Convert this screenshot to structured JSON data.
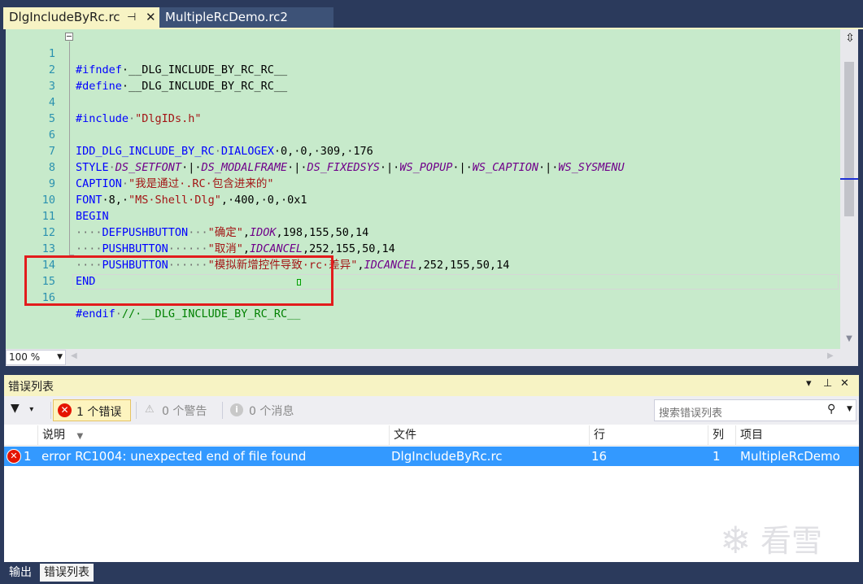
{
  "doc_tabs": [
    {
      "label": "DlgIncludeByRc.rc",
      "active": true
    },
    {
      "label": "MultipleRcDemo.rc2",
      "active": false
    }
  ],
  "editor": {
    "background": "#c7eacb",
    "line_numbers": [
      "1",
      "2",
      "3",
      "4",
      "5",
      "6",
      "7",
      "8",
      "9",
      "10",
      "11",
      "12",
      "13",
      "14",
      "15",
      "16"
    ],
    "lines": {
      "l1": {
        "a": "#ifndef",
        "b": "·__DLG_INCLUDE_BY_RC_RC__"
      },
      "l2": {
        "a": "#define",
        "b": "·__DLG_INCLUDE_BY_RC_RC__"
      },
      "l4": {
        "a": "#include",
        "b": "·",
        "c": "\"DlgIDs.h\""
      },
      "l6": {
        "a": "IDD_DLG_INCLUDE_BY_RC",
        "b": "·",
        "c": "DIALOGEX",
        "d": "·0,·0,·309,·176"
      },
      "l7": {
        "a": "STYLE",
        "b": "·",
        "c": "DS_SETFONT",
        "d": "·|·",
        "e": "DS_MODALFRAME",
        "f": "·|·",
        "g": "DS_FIXEDSYS",
        "h": "·|·",
        "i": "WS_POPUP",
        "j": "·|·",
        "k": "WS_CAPTION",
        "l": "·|·",
        "m": "WS_SYSMENU"
      },
      "l8": {
        "a": "CAPTION",
        "b": "·",
        "c": "\"我是通过·.RC·包含进来的\""
      },
      "l9": {
        "a": "FONT",
        "b": "·8,·",
        "c": "\"MS·Shell·Dlg\"",
        "d": ",·400,·0,·0x1"
      },
      "l10": {
        "a": "BEGIN"
      },
      "l11": {
        "a": "····",
        "b": "DEFPUSHBUTTON",
        "c": "···",
        "d": "\"确定\"",
        "e": ",",
        "f": "IDOK",
        "g": ",198,155,50,14"
      },
      "l12": {
        "a": "····",
        "b": "PUSHBUTTON",
        "c": "······",
        "d": "\"取消\"",
        "e": ",",
        "f": "IDCANCEL",
        "g": ",252,155,50,14"
      },
      "l13": {
        "a": "····",
        "b": "PUSHBUTTON",
        "c": "······",
        "d": "\"模拟新增控件导致·rc·差异\"",
        "e": ",",
        "f": "IDCANCEL",
        "g": ",252,155,50,14"
      },
      "l14": {
        "a": "END"
      },
      "l16": {
        "a": "#endif",
        "b": "·",
        "c": "//·__DLG_INCLUDE_BY_RC_RC__"
      }
    },
    "zoom": "100 %"
  },
  "error_list": {
    "title": "错误列表",
    "errors_label": "1 个错误",
    "warnings_label": "0 个警告",
    "messages_label": "0 个消息",
    "search_placeholder": "搜索错误列表",
    "columns": {
      "desc": "说明",
      "file": "文件",
      "line": "行",
      "col": "列",
      "project": "项目"
    },
    "row": {
      "index": "1",
      "desc": "error RC1004: unexpected end of file found",
      "file": "DlgIncludeByRc.rc",
      "line": "16",
      "col": "1",
      "project": "MultipleRcDemo"
    }
  },
  "bottom_tabs": {
    "output": "输出",
    "errors": "错误列表"
  },
  "watermark": {
    "text": "看雪",
    "icon": "snowflake-icon"
  },
  "icons": {
    "pin": "pin-icon",
    "close": "close-icon",
    "filter": "filter-icon",
    "error": "error-icon",
    "warning": "warning-icon",
    "info": "info-icon",
    "search": "search-icon",
    "split": "split-view-icon"
  },
  "colors": {
    "active_tab": "#f7f3c4",
    "selection": "#3399ff",
    "error_red": "#e51400",
    "highlight_box": "#e21c1c"
  }
}
